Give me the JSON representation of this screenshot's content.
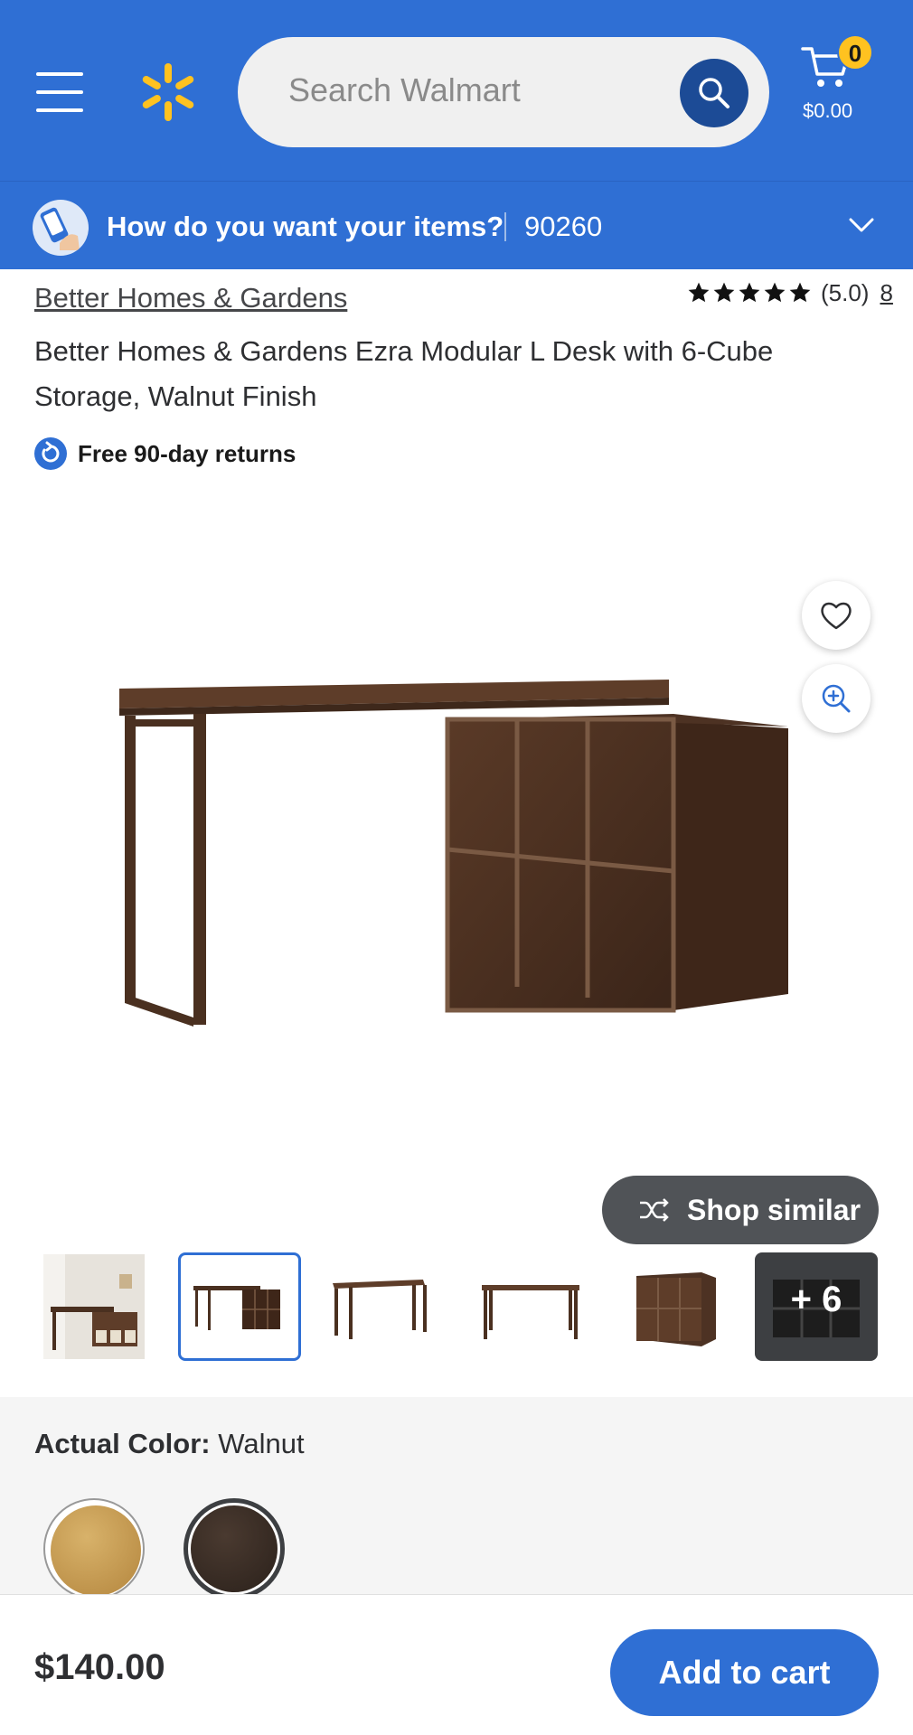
{
  "header": {
    "search_placeholder": "Search Walmart",
    "cart_count": "0",
    "cart_total": "$0.00"
  },
  "delivery": {
    "question": "How do you want your items?",
    "zip": "90260"
  },
  "product": {
    "brand": "Better Homes & Gardens",
    "rating_value": "(5.0)",
    "rating_count": "8",
    "stars": 5,
    "title": "Better Homes & Gardens Ezra Modular L Desk with 6-Cube Storage, Walnut Finish",
    "returns": "Free 90-day returns"
  },
  "gallery": {
    "shop_similar": "Shop similar",
    "more_images": "+ 6"
  },
  "color": {
    "label": "Actual Color:",
    "value": "Walnut",
    "swatches": [
      "oak",
      "walnut"
    ],
    "selected": "walnut"
  },
  "purchase": {
    "price": "$140.00",
    "add_to_cart": "Add to cart"
  },
  "colors": {
    "brand_blue": "#2f6fd4",
    "spark_yellow": "#ffc220",
    "search_button": "#1c4b96"
  }
}
